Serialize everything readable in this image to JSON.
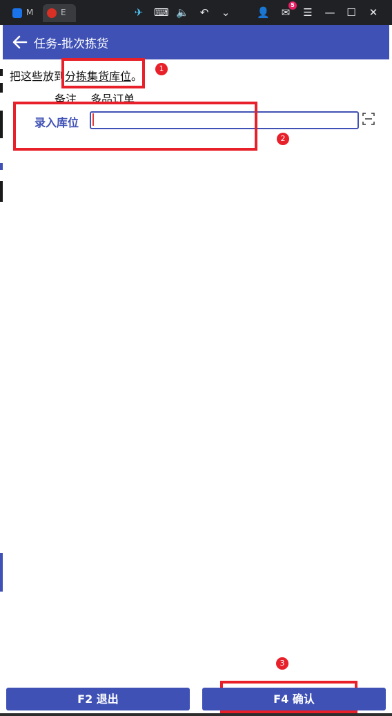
{
  "browser": {
    "tabs": [
      {
        "label": "M"
      },
      {
        "label": "E"
      }
    ],
    "mail_badge": "5"
  },
  "header": {
    "title": "任务-批次拣货",
    "back_icon": "arrow-left-icon"
  },
  "instruction": {
    "prefix": "把这些放到",
    "link": "分拣集货库位",
    "suffix": "。"
  },
  "remark": {
    "label": "备注",
    "value": "多品订单"
  },
  "location_field": {
    "label": "录入库位",
    "value": "",
    "scan_icon": "scan-icon"
  },
  "annotations": [
    "1",
    "2",
    "3"
  ],
  "buttons": {
    "exit": "F2 退出",
    "confirm": "F4 确认"
  },
  "colors": {
    "primary": "#3f51b5",
    "annotation": "#e8202a"
  }
}
